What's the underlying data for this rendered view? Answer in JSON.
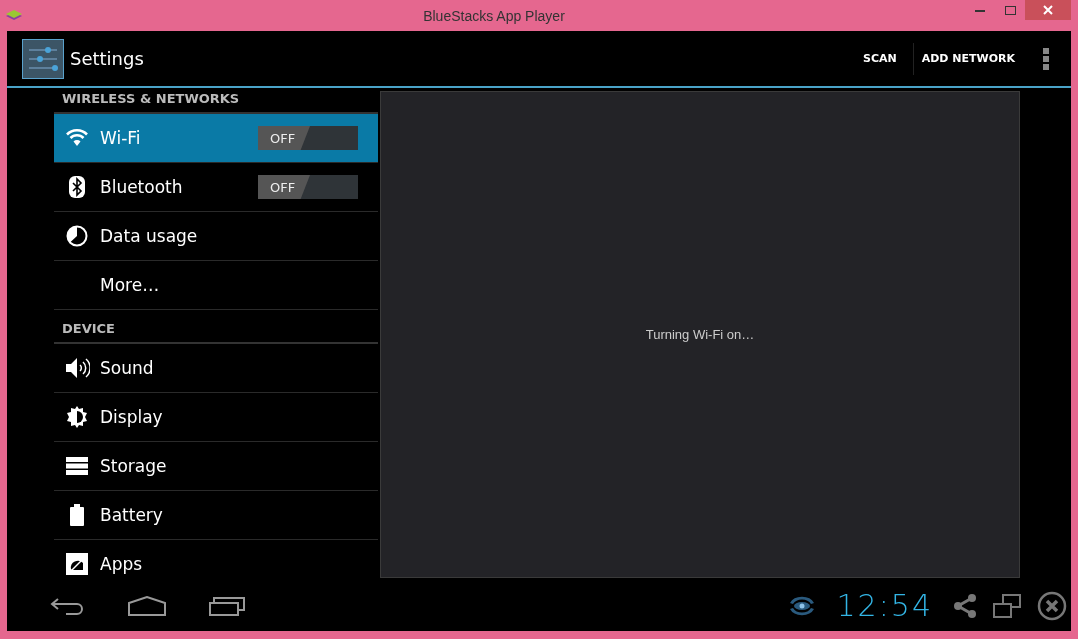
{
  "window": {
    "title": "BlueStacks App Player"
  },
  "action_bar": {
    "title": "Settings",
    "actions": [
      "SCAN",
      "ADD NETWORK"
    ]
  },
  "sections": [
    {
      "header": "WIRELESS & NETWORKS",
      "items": [
        {
          "label": "Wi-Fi",
          "kind": "toggle",
          "selected": true,
          "on": false,
          "state_label": "OFF"
        },
        {
          "label": "Bluetooth",
          "kind": "toggle",
          "selected": false,
          "on": false,
          "state_label": "OFF"
        },
        {
          "label": "Data usage",
          "kind": "plain",
          "selected": false
        },
        {
          "label": "More…",
          "kind": "plain",
          "selected": false
        }
      ]
    },
    {
      "header": "DEVICE",
      "items": [
        {
          "label": "Sound",
          "kind": "plain",
          "selected": false
        },
        {
          "label": "Display",
          "kind": "plain",
          "selected": false
        },
        {
          "label": "Storage",
          "kind": "plain",
          "selected": false
        },
        {
          "label": "Battery",
          "kind": "plain",
          "selected": false
        },
        {
          "label": "Apps",
          "kind": "plain",
          "selected": false
        }
      ]
    }
  ],
  "detail": {
    "message": "Turning Wi-Fi on…"
  },
  "status_bar": {
    "time": "12:54"
  }
}
